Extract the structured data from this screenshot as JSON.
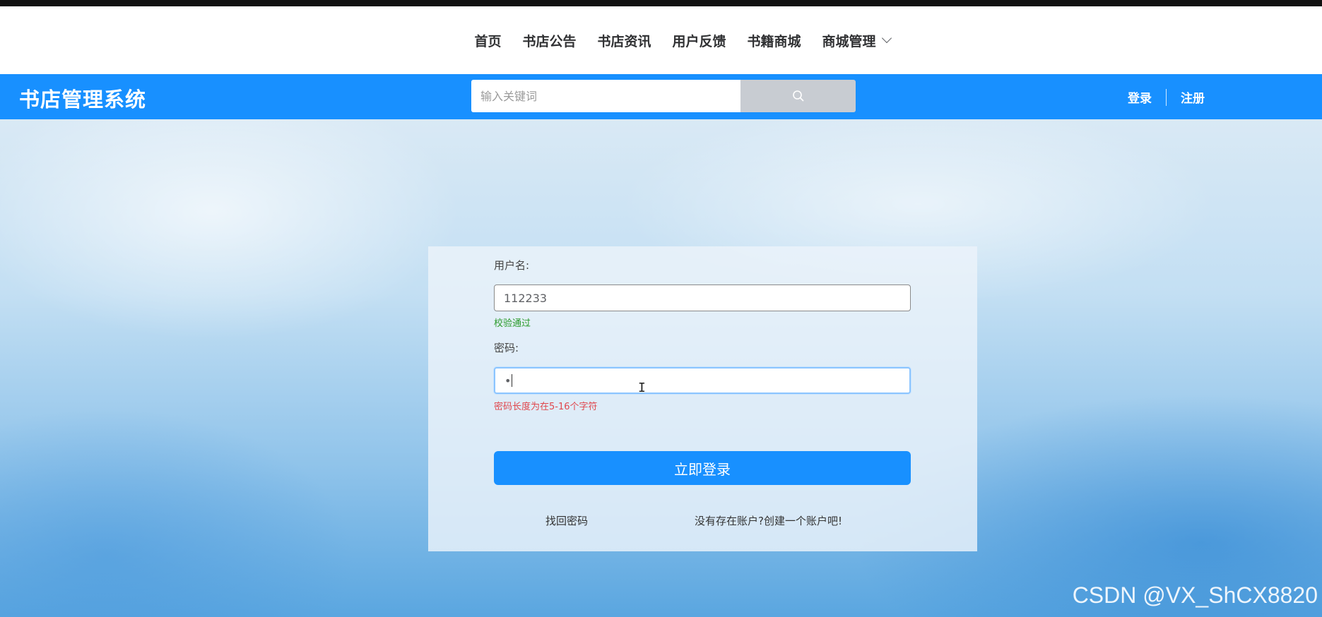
{
  "nav": {
    "items": [
      {
        "label": "首页"
      },
      {
        "label": "书店公告"
      },
      {
        "label": "书店资讯"
      },
      {
        "label": "用户反馈"
      },
      {
        "label": "书籍商城"
      },
      {
        "label": "商城管理"
      }
    ]
  },
  "header": {
    "brand": "书店管理系统",
    "search": {
      "placeholder": "输入关键词",
      "value": ""
    },
    "login_label": "登录",
    "register_label": "注册"
  },
  "form": {
    "username_label": "用户名:",
    "username_value": "112233",
    "username_msg": "校验通过",
    "password_label": "密码:",
    "password_value": "•",
    "password_msg": "密码长度为在5-16个字符",
    "submit_label": "立即登录",
    "forgot_label": "找回密码",
    "create_label": "没有存在账户?创建一个账户吧!"
  },
  "watermark": "CSDN @VX_ShCX8820",
  "colors": {
    "accent": "#1890ff",
    "ok": "#2a9a2a",
    "error": "#e0474c"
  }
}
